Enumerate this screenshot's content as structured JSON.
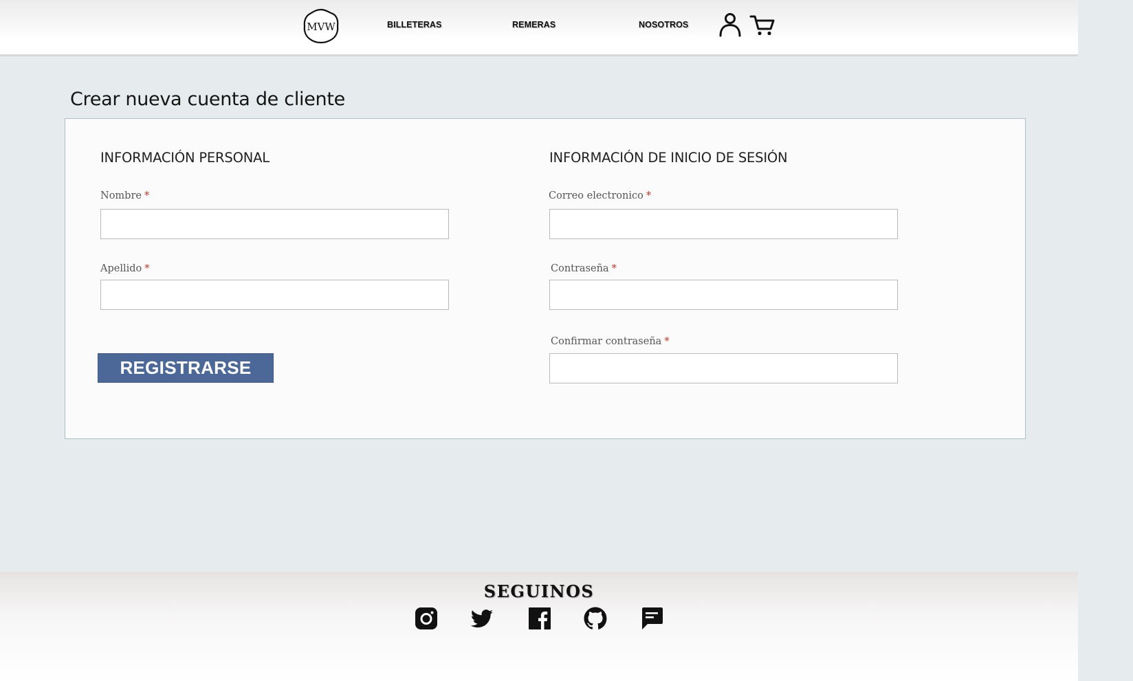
{
  "header": {
    "logo_text": "MVW",
    "nav": {
      "billeteras": "BILLETERAS",
      "remeras": "REMERAS",
      "nosotros": "NOSOTROS"
    },
    "icons": [
      "user-icon",
      "cart-icon"
    ]
  },
  "main": {
    "title": "Crear nueva cuenta de cliente",
    "personal": {
      "heading": "INFORMACIÓN PERSONAL",
      "nombre_label": "Nombre",
      "nombre_value": "",
      "apellido_label": "Apellido",
      "apellido_value": ""
    },
    "login": {
      "heading": "INFORMACIÓN DE INICIO DE SESIÓN",
      "correo_label": "Correo electronico",
      "correo_value": "",
      "pass_label": "Contraseña",
      "pass_value": "",
      "confirm_label": "Confirmar contraseña",
      "confirm_value": ""
    },
    "required_marker": "*",
    "submit_label": "REGISTRARSE"
  },
  "footer": {
    "title": "SEGUINOS",
    "social_icons": [
      "instagram-icon",
      "twitter-icon",
      "facebook-icon",
      "github-icon",
      "chat-icon"
    ]
  },
  "colors": {
    "background": "#e6eced",
    "panel": "#fbfbfb",
    "panel_border": "#a8c2c4",
    "button": "#4b6898",
    "required": "#c0392b"
  }
}
